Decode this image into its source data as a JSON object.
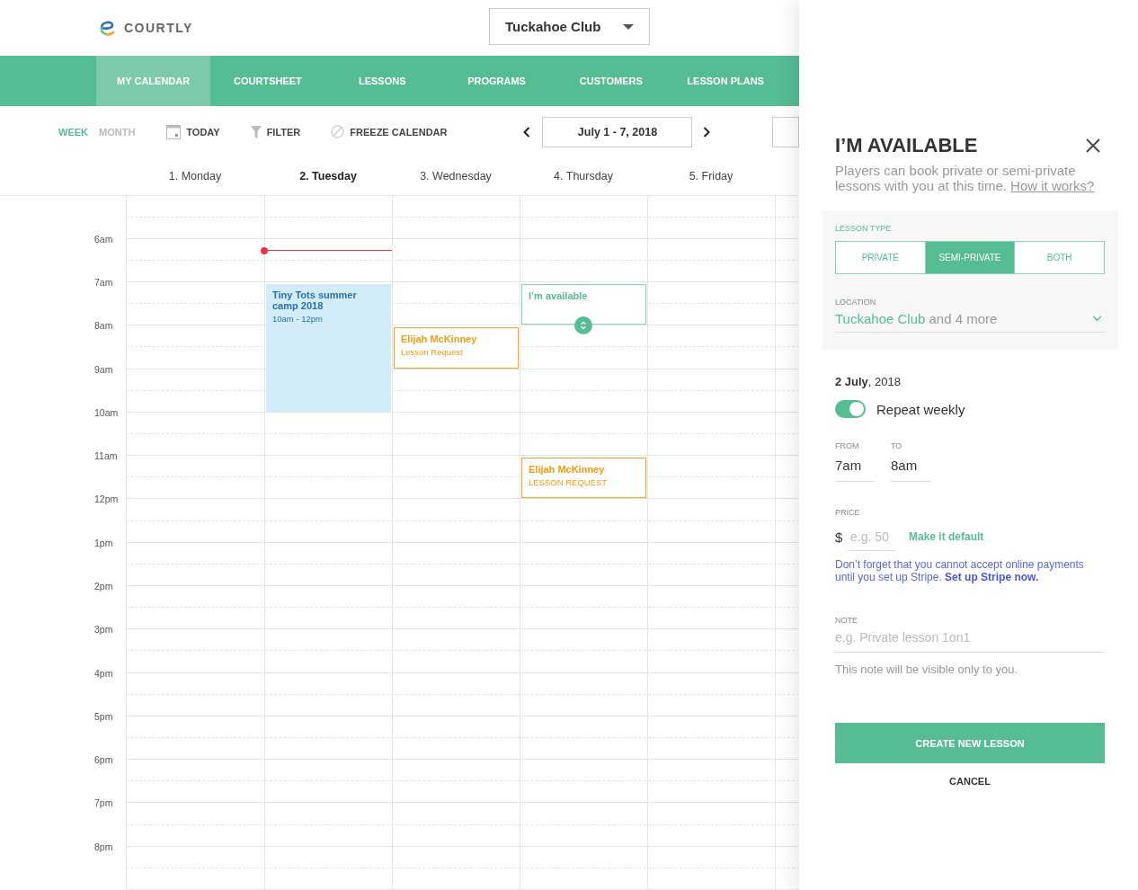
{
  "header": {
    "logo": "COURTLY",
    "club_select": {
      "value": "Tuckahoe Club"
    }
  },
  "nav": [
    {
      "label": "MY CALENDAR",
      "selected": true
    },
    {
      "label": "COURTSHEET",
      "selected": false
    },
    {
      "label": "LESSONS",
      "selected": false
    },
    {
      "label": "PROGRAMS",
      "selected": false
    },
    {
      "label": "CUSTOMERS",
      "selected": false
    },
    {
      "label": "LESSON PLANS",
      "selected": false
    }
  ],
  "toolbar": {
    "views": [
      {
        "label": "WEEK",
        "selected": true
      },
      {
        "label": "MONTH",
        "selected": false
      }
    ],
    "actions": [
      {
        "label": "TODAY",
        "kind": "today"
      },
      {
        "label": "FILTER",
        "kind": "filter"
      },
      {
        "label": "FREEZE CALENDAR",
        "kind": "freeze"
      }
    ],
    "date_range": "July 1 - 7, 2018"
  },
  "days": [
    {
      "label": "1. Monday",
      "selected": false
    },
    {
      "label": "2. Tuesday",
      "selected": true
    },
    {
      "label": "3. Wednesday",
      "selected": false
    },
    {
      "label": "4. Thursday",
      "selected": false
    },
    {
      "label": "5. Friday",
      "selected": false
    }
  ],
  "hours": [
    "6am",
    "7am",
    "8am",
    "9am",
    "10am",
    "11am",
    "12pm",
    "1pm",
    "2pm",
    "3pm",
    "4pm",
    "5pm",
    "6pm",
    "7pm",
    "8pm"
  ],
  "events": [
    {
      "kind": "program",
      "title": "Tiny Tots summer camp 2018",
      "subtitle": "10am - 12pm"
    },
    {
      "kind": "request",
      "title": "Elijah McKinney",
      "subtitle": "Lesson Request"
    },
    {
      "kind": "availability",
      "title": "I’m available"
    },
    {
      "kind": "request",
      "title": "Elijah McKinney",
      "subtitle": "LESSON REQUEST"
    }
  ],
  "panel": {
    "title": "I’M AVAILABLE",
    "description": "Players can book private or semi-private lessons with you at this time.",
    "help_link": "How it works?",
    "lesson_type": {
      "label": "LESSON TYPE",
      "options": [
        {
          "label": "PRIVATE",
          "selected": false
        },
        {
          "label": "SEMI-PRIVATE",
          "selected": true
        },
        {
          "label": "BOTH",
          "selected": false
        }
      ]
    },
    "location": {
      "label": "LOCATION",
      "value": "Tuckahoe Club",
      "more": "and 4 more"
    },
    "date": "**2 July**, 2018",
    "repeat": {
      "label": "Repeat weekly",
      "on": true
    },
    "from": {
      "label": "FROM",
      "value": "7am"
    },
    "to": {
      "label": "TO",
      "value": "8am"
    },
    "price": {
      "label": "PRICE",
      "currency": "$",
      "placeholder": "e.g. 50",
      "default_link": "Make it default"
    },
    "stripe_notice": {
      "text": "Don’t forget that you cannot accept online payments until you set up Stripe.",
      "link": "Set up Stripe now."
    },
    "note": {
      "label": "NOTE",
      "placeholder": "e.g. Private lesson 1on1",
      "hint": "This note will be visible only to you."
    },
    "buttons": {
      "create": "CREATE NEW LESSON",
      "cancel": "CANCEL"
    }
  }
}
